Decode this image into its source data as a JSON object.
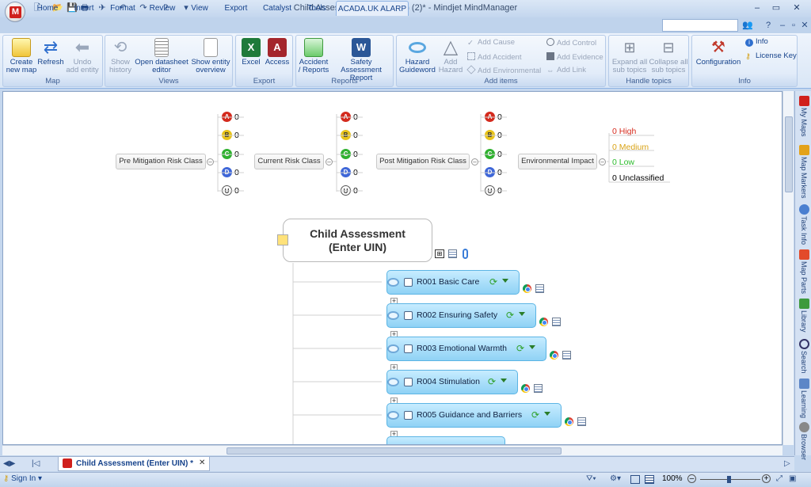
{
  "window": {
    "title": "Child Assessment (Enter UIN)  (2)* - Mindjet MindManager",
    "app_logo_letter": "M",
    "controls": {
      "minimize": "–",
      "restore": "▭",
      "close": "✕"
    }
  },
  "tabs": [
    {
      "label": "Home"
    },
    {
      "label": "Insert"
    },
    {
      "label": "Format"
    },
    {
      "label": "Review"
    },
    {
      "label": "View"
    },
    {
      "label": "Export"
    },
    {
      "label": "Catalyst"
    },
    {
      "label": "Tools"
    },
    {
      "label": "ACADA.UK ALARP",
      "active": true
    }
  ],
  "ribbon": {
    "groups": {
      "map": "Map",
      "views": "Views",
      "export": "Export",
      "reports": "Reports",
      "add_items": "Add items",
      "handle_topics": "Handle topics",
      "info": "Info"
    },
    "buttons": {
      "create_new_map": "Create\nnew map",
      "refresh": "Refresh",
      "undo_add_entity": "Undo\nadd entity",
      "show_history": "Show\nhistory",
      "open_datasheet_editor": "Open datasheet\neditor",
      "show_entity_overview": "Show entity\noverview",
      "excel": "Excel",
      "access": "Access",
      "accident_reports": "Accident\n/ Reports",
      "safety_assessment_report": "Safety Assessment\nReport",
      "hazard_guideword": "Hazard\nGuideword",
      "add_hazard": "Add\nHazard",
      "add_cause": "Add Cause",
      "add_accident": "Add Accident",
      "add_environmental": "Add Environmental",
      "add_control": "Add Control",
      "add_evidence": "Add Evidence",
      "add_link": "Add Link",
      "expand_all_sub_topics": "Expand all\nsub topics",
      "collapse_all_sub_topics": "Collapse all\nsub topics",
      "configuration": "Configuration",
      "info": "Info",
      "license_key": "License Key"
    }
  },
  "map": {
    "risk_columns": [
      {
        "label": "Pre Mitigation Risk Class",
        "values": [
          "0",
          "0",
          "0",
          "0",
          "0"
        ]
      },
      {
        "label": "Current Risk Class",
        "values": [
          "0",
          "0",
          "0",
          "0",
          "0"
        ]
      },
      {
        "label": "Post Mitigation Risk Class",
        "values": [
          "0",
          "0",
          "0",
          "0",
          "0"
        ]
      }
    ],
    "risk_letters": [
      "A",
      "B",
      "C",
      "D",
      "U"
    ],
    "risk_colors": [
      "#d42a1d",
      "#e8c31b",
      "#2fb12f",
      "#3f67d8",
      "#ffffff"
    ],
    "environmental_impact": {
      "label": "Environmental Impact",
      "items": [
        {
          "text": "0 High",
          "color": "#d62b1e"
        },
        {
          "text": "0 Medium",
          "color": "#d9a316"
        },
        {
          "text": "0 Low",
          "color": "#2dbb2d"
        },
        {
          "text": "0 Unclassified",
          "color": "#000000"
        }
      ]
    },
    "central_topic": "Child Assessment\n(Enter UIN)",
    "requirements": [
      {
        "label": "R001 Basic Care"
      },
      {
        "label": "R002 Ensuring Safety"
      },
      {
        "label": "R003 Emotional Warmth"
      },
      {
        "label": "R004 Stimulation"
      },
      {
        "label": "R005 Guidance and Barriers"
      }
    ]
  },
  "side_panel": [
    "My Maps",
    "Map Markers",
    "Task Info",
    "Map Parts",
    "Library",
    "Search",
    "Learning",
    "Browser"
  ],
  "doc_tab": {
    "label": "Child Assessment (Enter UIN) *"
  },
  "status": {
    "sign_in": "Sign In",
    "zoom": "100%"
  }
}
